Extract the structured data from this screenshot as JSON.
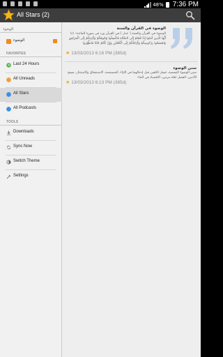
{
  "status_bar": {
    "battery": "48%",
    "time": "7:36 PM"
  },
  "action_bar": {
    "title": "All Stars (2)",
    "search_icon": "search-icon",
    "app_icon": "star-icon"
  },
  "drawer": {
    "feeds_header": "الوضوء",
    "feed_item_label": "الوضوء",
    "favorites_header": "FAVORITES",
    "favorites": [
      {
        "label": "Last 24 Hours",
        "icon": "clock-green-icon"
      },
      {
        "label": "All Unreads",
        "icon": "unread-orange-icon"
      },
      {
        "label": "All Stars",
        "icon": "star-blue-icon"
      },
      {
        "label": "All Podcasts",
        "icon": "podcast-blue-icon"
      }
    ],
    "tools_header": "TOOLS",
    "tools": [
      {
        "label": "Downloads",
        "icon": "download-icon"
      },
      {
        "label": "Sync Now",
        "icon": "sync-icon"
      },
      {
        "label": "Switch Theme",
        "icon": "theme-icon"
      },
      {
        "label": "Settings",
        "icon": "settings-icon"
      }
    ]
  },
  "articles": [
    {
      "title": "الوضوء في القرآن والسنة",
      "body": "الوضوء في القرآن والسنة [ عدل ] في القرآن ورد في سورة المائدة: ﴿يَا أَيُّهَا الَّذِينَ آمَنُوا إِذَا قُمْتُمْ إِلَى الصَّلَاةِ فَاغْسِلُوا وُجُوهَكُمْ وَأَيْدِيَكُمْ إِلَى الْمَرَافِقِ وَامْسَحُوا بِرُءُوسِكُمْ وَأَرْجُلَكُمْ إِلَى الْكَعْبَيْنِ وَإِنْ كُنْتُمْ جُنُبًا فَاطَّهَّرُوا",
      "meta": "13/03/2013 6:16 PM (385d)"
    },
    {
      "title": "سنن الوضوء",
      "body": "سنن الوضوء التسمية، غسل الكفين قبل إدخالهما في الإناء، المضمضة، الاستنشاق والاستنثار، مسح الأذنين، الفصل لغاه مرتين، الاقتصاد في الماء",
      "meta": "13/03/2013 6:13 PM (385d)"
    }
  ],
  "colors": {
    "action_bar": "#3d3d3d",
    "drawer_bg": "#f1f1f1",
    "list_bg": "#eeeeee",
    "star": "#f2a514",
    "rss": "#f28a1c"
  }
}
